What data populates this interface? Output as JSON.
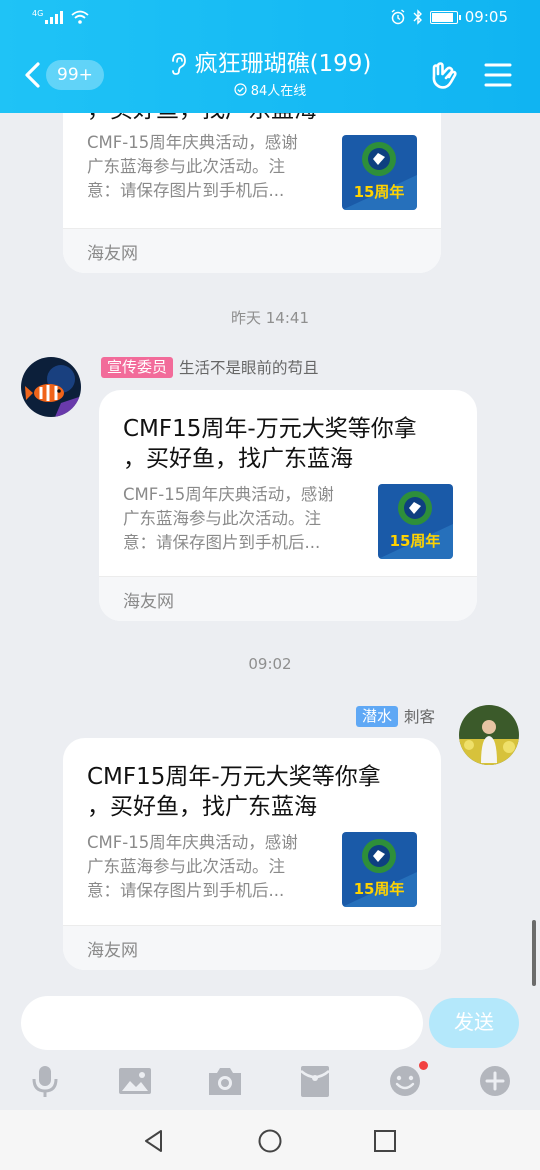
{
  "statusbar": {
    "network": "4G",
    "time": "09:05"
  },
  "header": {
    "unread_count": "99+",
    "title": "疯狂珊瑚礁(199)",
    "online": "84人在线"
  },
  "link_card": {
    "title": "CMF15周年-万元大奖等你拿，买好鱼，找广东蓝海",
    "title_line1": "CMF15周年-万元大奖等你拿",
    "title_line2": "，买好鱼，找广东蓝海",
    "desc_line1": "CMF-15周年庆典活动，感谢",
    "desc_line2": "广东蓝海参与此次活动。注",
    "desc_line3": "意：请保存图片到手机后...",
    "thumb_text": "15周年",
    "source": "海友网"
  },
  "messages": [
    {
      "timestamp": "昨天 14:41",
      "badge": "宣传委员",
      "sender": "生活不是眼前的苟且"
    },
    {
      "timestamp": "09:02",
      "badge": "潜水",
      "sender": "刺客"
    }
  ],
  "composer": {
    "placeholder": "",
    "send_label": "发送"
  },
  "colors": {
    "accent": "#12b7f5",
    "send_disabled": "#b4e8fb",
    "badge_pink": "#f26b9a",
    "badge_blue": "#5fa8f5"
  }
}
